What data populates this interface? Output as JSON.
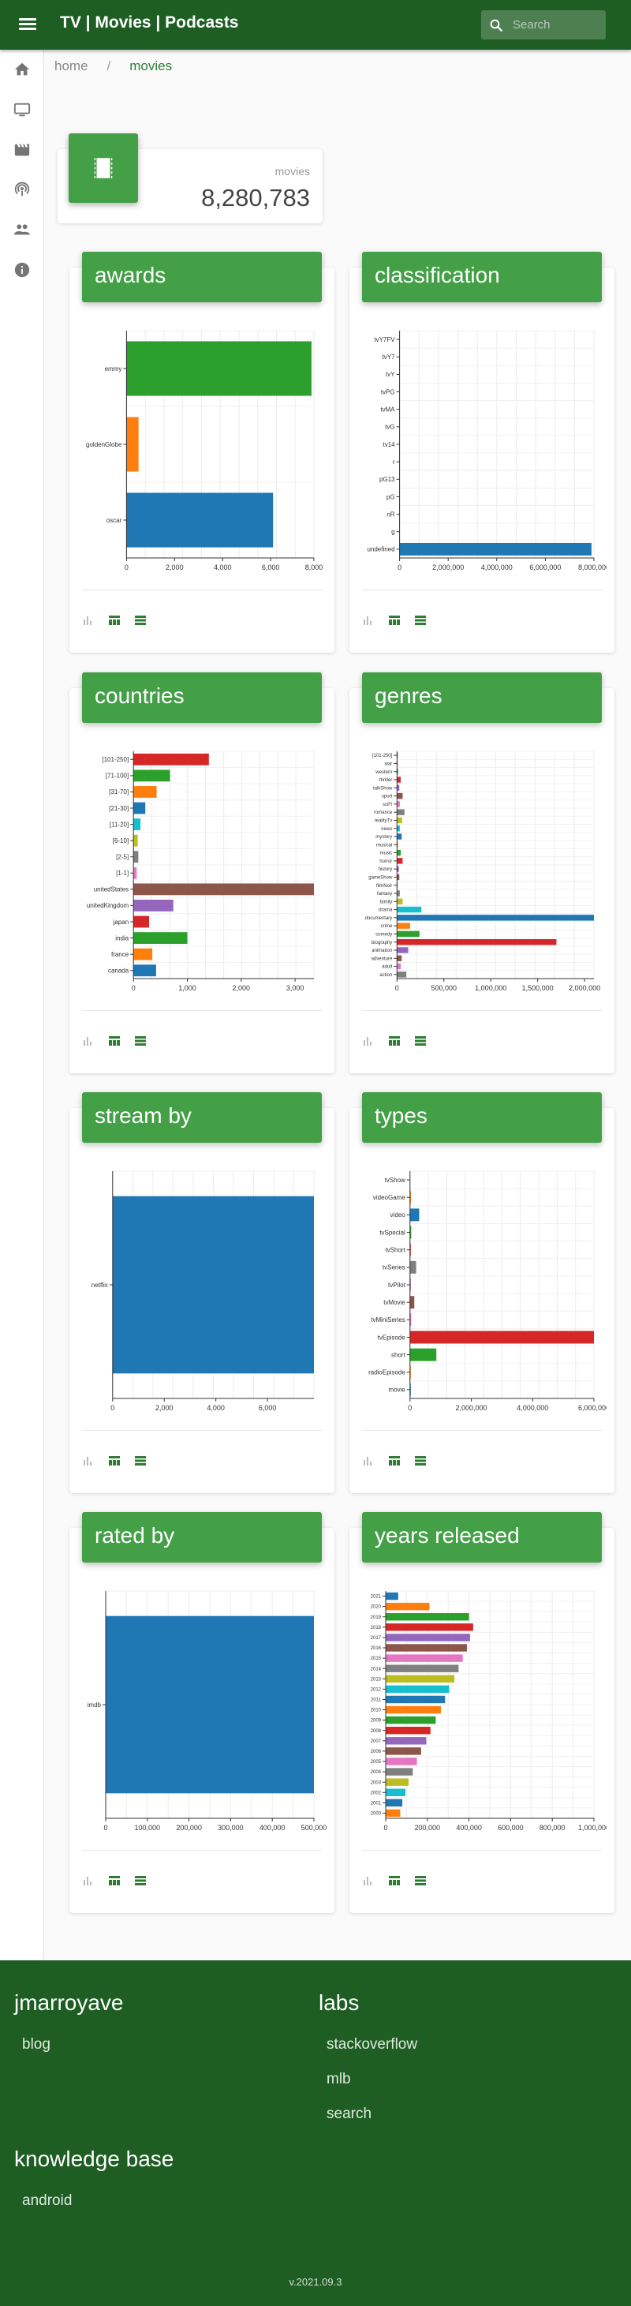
{
  "topbar": {
    "title": "TV | Movies | Podcasts",
    "search_placeholder": "Search"
  },
  "sidebar": {
    "items": [
      {
        "icon": "home-icon",
        "label": "home"
      },
      {
        "icon": "tv-icon",
        "label": "tv"
      },
      {
        "icon": "movie-icon",
        "label": "movies"
      },
      {
        "icon": "podcast-icon",
        "label": "podcasts"
      },
      {
        "icon": "people-icon",
        "label": "people"
      },
      {
        "icon": "info-icon",
        "label": "about"
      }
    ]
  },
  "breadcrumb": {
    "home": "home",
    "current": "movies"
  },
  "stat": {
    "label": "movies",
    "value": "8,280,783"
  },
  "cards": {
    "awards": {
      "title": "awards"
    },
    "classification": {
      "title": "classification"
    },
    "countries": {
      "title": "countries"
    },
    "genres": {
      "title": "genres"
    },
    "stream_by": {
      "title": "stream by"
    },
    "types": {
      "title": "types"
    },
    "rated_by": {
      "title": "rated by"
    },
    "years_released": {
      "title": "years released"
    }
  },
  "chart_data": [
    {
      "id": "awards",
      "type": "bar",
      "orientation": "horizontal",
      "categories": [
        "emmy",
        "goldenGlobe",
        "oscar"
      ],
      "values": [
        7700,
        500,
        6100
      ],
      "colors": [
        "#2ca02c",
        "#ff7f0e",
        "#1f77b4"
      ],
      "xlim": [
        0,
        7800
      ],
      "xticks": [
        0,
        2000,
        4000,
        6000,
        8000
      ],
      "xtick_labels": [
        "0",
        "2,000",
        "4,000",
        "6,000",
        "8,000"
      ],
      "grid": true
    },
    {
      "id": "classification",
      "type": "bar",
      "orientation": "horizontal",
      "categories": [
        "tvY7FV",
        "tvY7",
        "tvY",
        "tvPG",
        "tvMA",
        "tvG",
        "tv14",
        "r",
        "pG13",
        "pG",
        "nR",
        "g",
        "undefined"
      ],
      "values": [
        0,
        0,
        0,
        0,
        0,
        0,
        0,
        0,
        0,
        0,
        0,
        0,
        7900000
      ],
      "colors": [
        "#1f77b4"
      ],
      "xlim": [
        0,
        8000000
      ],
      "xticks": [
        0,
        2000000,
        4000000,
        6000000,
        8000000
      ],
      "xtick_labels": [
        "0",
        "2,000,000",
        "4,000,000",
        "6,000,000",
        "8,000,000"
      ],
      "grid": true
    },
    {
      "id": "countries",
      "type": "bar",
      "orientation": "horizontal",
      "categories": [
        "[101-250]",
        "[71-100]",
        "[31-70]",
        "[21-30]",
        "[11-20]",
        "[6-10]",
        "[2-5]",
        "[1-1]",
        "unitedStates",
        "unitedKingdom",
        "japan",
        "india",
        "france",
        "canada"
      ],
      "values": [
        1400,
        680,
        430,
        220,
        130,
        80,
        90,
        60,
        3350,
        740,
        290,
        1000,
        350,
        420
      ],
      "colors": [
        "#d62728",
        "#2ca02c",
        "#ff7f0e",
        "#1f77b4",
        "#17becf",
        "#bcbd22",
        "#7f7f7f",
        "#e377c2",
        "#8c564b",
        "#9467bd",
        "#d62728",
        "#2ca02c",
        "#ff7f0e",
        "#1f77b4"
      ],
      "xlim": [
        0,
        3350
      ],
      "xticks": [
        0,
        1000,
        2000,
        3000
      ],
      "xtick_labels": [
        "0",
        "1,000",
        "2,000",
        "3,000"
      ],
      "grid": true
    },
    {
      "id": "genres",
      "type": "bar",
      "orientation": "horizontal",
      "categories": [
        "[101-250]",
        "war",
        "western",
        "thriller",
        "talkShow",
        "sport",
        "sciFi",
        "romance",
        "realityTv",
        "news",
        "mystery",
        "musical",
        "music",
        "horror",
        "history",
        "gameShow",
        "filmNoir",
        "fantasy",
        "family",
        "drama",
        "documentary",
        "crime",
        "comedy",
        "biography",
        "animation",
        "adventure",
        "adult",
        "action"
      ],
      "values": [
        5000,
        9000,
        12000,
        40000,
        25000,
        60000,
        30000,
        80000,
        55000,
        30000,
        50000,
        10000,
        40000,
        60000,
        20000,
        25000,
        5000,
        30000,
        60000,
        260000,
        2100000,
        140000,
        240000,
        1700000,
        120000,
        50000,
        40000,
        100000
      ],
      "colors": [
        "#1f77b4",
        "#ff7f0e",
        "#2ca02c",
        "#d62728",
        "#9467bd",
        "#8c564b",
        "#e377c2",
        "#7f7f7f",
        "#bcbd22",
        "#17becf"
      ],
      "xlim": [
        0,
        2100000
      ],
      "xticks": [
        0,
        500000,
        1000000,
        1500000,
        2000000
      ],
      "xtick_labels": [
        "0",
        "500,000",
        "1,000,000",
        "1,500,000",
        "2,000,000"
      ],
      "grid": true
    },
    {
      "id": "stream_by",
      "type": "bar",
      "orientation": "horizontal",
      "categories": [
        "netflix"
      ],
      "values": [
        7800
      ],
      "colors": [
        "#1f77b4"
      ],
      "xlim": [
        0,
        7800
      ],
      "xticks": [
        0,
        2000,
        4000,
        6000
      ],
      "xtick_labels": [
        "0",
        "2,000",
        "4,000",
        "6,000"
      ],
      "grid": true
    },
    {
      "id": "types",
      "type": "bar",
      "orientation": "horizontal",
      "categories": [
        "tvShow",
        "videoGame",
        "video",
        "tvSpecial",
        "tvShort",
        "tvSeries",
        "tvPilot",
        "tvMovie",
        "tvMiniSeries",
        "tvEpisode",
        "short",
        "radioEpisode",
        "movie"
      ],
      "values": [
        0,
        30000,
        300000,
        40000,
        20000,
        200000,
        1000,
        140000,
        40000,
        6000000,
        860000,
        1000,
        20000
      ],
      "colors": [
        "#1f77b4",
        "#ff7f0e",
        "#1f77b4",
        "#2ca02c",
        "#d62728",
        "#7f7f7f",
        "#9467bd",
        "#8c564b",
        "#e377c2",
        "#d62728",
        "#2ca02c",
        "#ff7f0e",
        "#1f77b4"
      ],
      "xlim": [
        0,
        6000000
      ],
      "xticks": [
        0,
        2000000,
        4000000,
        6000000
      ],
      "xtick_labels": [
        "0",
        "2,000,000",
        "4,000,000",
        "6,000,000"
      ],
      "grid": true
    },
    {
      "id": "rated_by",
      "type": "bar",
      "orientation": "horizontal",
      "categories": [
        "imdb"
      ],
      "values": [
        500000
      ],
      "colors": [
        "#1f77b4"
      ],
      "xlim": [
        0,
        500000
      ],
      "xticks": [
        0,
        100000,
        200000,
        300000,
        400000,
        500000
      ],
      "xtick_labels": [
        "0",
        "100,000",
        "200,000",
        "300,000",
        "400,000",
        "500,000"
      ],
      "grid": true
    },
    {
      "id": "years_released",
      "type": "bar",
      "orientation": "horizontal",
      "categories": [
        "2021",
        "2020",
        "2019",
        "2018",
        "2017",
        "2016",
        "2015",
        "2014",
        "2013",
        "2012",
        "2011",
        "2010",
        "2009",
        "2008",
        "2007",
        "2006",
        "2005",
        "2004",
        "2003",
        "2002",
        "2001",
        "2000"
      ],
      "values": [
        60000,
        210000,
        400000,
        420000,
        405000,
        390000,
        370000,
        350000,
        330000,
        305000,
        285000,
        265000,
        240000,
        215000,
        195000,
        170000,
        150000,
        130000,
        110000,
        95000,
        80000,
        70000
      ],
      "colors": [
        "#1f77b4",
        "#ff7f0e",
        "#2ca02c",
        "#d62728",
        "#9467bd",
        "#8c564b",
        "#e377c2",
        "#7f7f7f",
        "#bcbd22",
        "#17becf"
      ],
      "xlim": [
        0,
        1000000
      ],
      "xticks": [
        0,
        200000,
        400000,
        600000,
        800000,
        1000000
      ],
      "xtick_labels": [
        "0",
        "200,000",
        "400,000",
        "600,000",
        "800,000",
        "1,000,000"
      ],
      "grid": true
    }
  ],
  "footer": {
    "col1_title": "jmarroyave",
    "col1_links": [
      "blog"
    ],
    "col2_title": "labs",
    "col2_links": [
      "stackoverflow",
      "mlb",
      "search"
    ],
    "col3_title": "knowledge base",
    "col3_links": [
      "android"
    ],
    "version": "v.2021.09.3"
  }
}
